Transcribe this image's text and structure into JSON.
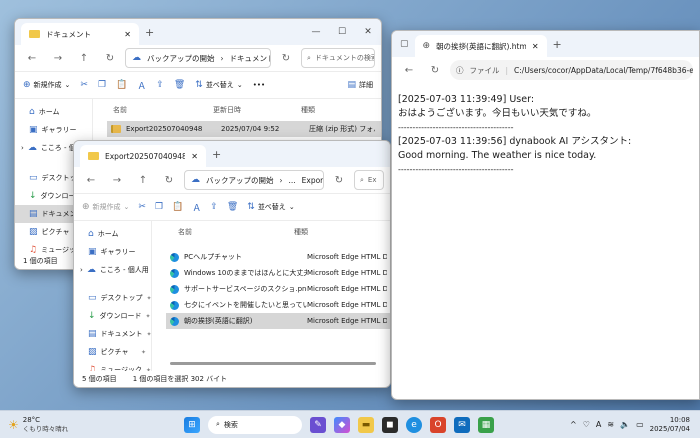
{
  "explorer_back": {
    "tab_title": "ドキュメント",
    "breadcrumb": [
      "バックアップの開始",
      "ドキュメント"
    ],
    "search_placeholder": "ドキュメントの検索",
    "cmd": {
      "new": "新規作成",
      "sort": "並べ替え",
      "details": "詳細"
    },
    "columns": {
      "name": "名前",
      "date": "更新日時",
      "type": "種類"
    },
    "rows": [
      {
        "name": "Export202507040948",
        "date": "2025/07/04 9:52",
        "type": "圧縮 (zip 形式) フォル..."
      }
    ],
    "sidebar": [
      {
        "label": "ホーム",
        "icon": "home-icon"
      },
      {
        "label": "ギャラリー",
        "icon": "gallery-icon"
      },
      {
        "label": "こころ - 個人用",
        "icon": "cloud-icon"
      },
      {
        "label": "デスクトップ",
        "icon": "desktop-icon"
      },
      {
        "label": "ダウンロード",
        "icon": "download-icon"
      },
      {
        "label": "ドキュメント",
        "icon": "document-icon"
      },
      {
        "label": "ピクチャ",
        "icon": "picture-icon"
      },
      {
        "label": "ミュージック",
        "icon": "music-icon"
      }
    ],
    "status": "1 個の項目"
  },
  "explorer_front": {
    "tab_title": "Export202507040948",
    "breadcrumb": [
      "バックアップの開始",
      "...",
      "Export202507"
    ],
    "search_placeholder": "Ex",
    "cmd": {
      "new": "新規作成",
      "sort": "並べ替え"
    },
    "columns": {
      "name": "名前",
      "type": "種類"
    },
    "rows": [
      {
        "name": "PCヘルプチャット",
        "type": "Microsoft Edge HTML Docu"
      },
      {
        "name": "Windows 10のままではほんとに大丈夫？.png",
        "type": "Microsoft Edge HTML Docu"
      },
      {
        "name": "サポートサービスページのスクショ.png",
        "type": "Microsoft Edge HTML Docu"
      },
      {
        "name": "七夕にイベントを開催したいと思っています。子...",
        "type": "Microsoft Edge HTML Docu"
      },
      {
        "name": "朝の挨拶(英語に翻訳)",
        "type": "Microsoft Edge HTML Docu"
      }
    ],
    "sidebar": [
      {
        "label": "ホーム",
        "icon": "home-icon"
      },
      {
        "label": "ギャラリー",
        "icon": "gallery-icon"
      },
      {
        "label": "こころ - 個人用",
        "icon": "cloud-icon"
      },
      {
        "label": "デスクトップ",
        "icon": "desktop-icon"
      },
      {
        "label": "ダウンロード",
        "icon": "download-icon"
      },
      {
        "label": "ドキュメント",
        "icon": "document-icon"
      },
      {
        "label": "ピクチャ",
        "icon": "picture-icon"
      },
      {
        "label": "ミュージック",
        "icon": "music-icon"
      }
    ],
    "status_count": "5 個の項目",
    "status_sel": "1 個の項目を選択 302 バイト"
  },
  "browser": {
    "tab_title": "朝の挨拶(英語に翻訳).html",
    "address_label": "ファイル",
    "address": "C:/Users/cocor/AppData/Local/Temp/7f648b36-e7d0-4cee-a7f9-5",
    "lines": [
      "[2025-07-03 11:39:49] User:",
      "おはようございます。今日もいい天気ですね。",
      "----------------------------------------",
      "[2025-07-03 11:39:56] dynabook AI アシスタント:",
      "Good morning. The weather is nice today.",
      "----------------------------------------"
    ]
  },
  "taskbar": {
    "weather_temp": "28°C",
    "weather_text": "くもり時々晴れ",
    "search_label": "検索",
    "time": "10:08",
    "date": "2025/07/04"
  }
}
